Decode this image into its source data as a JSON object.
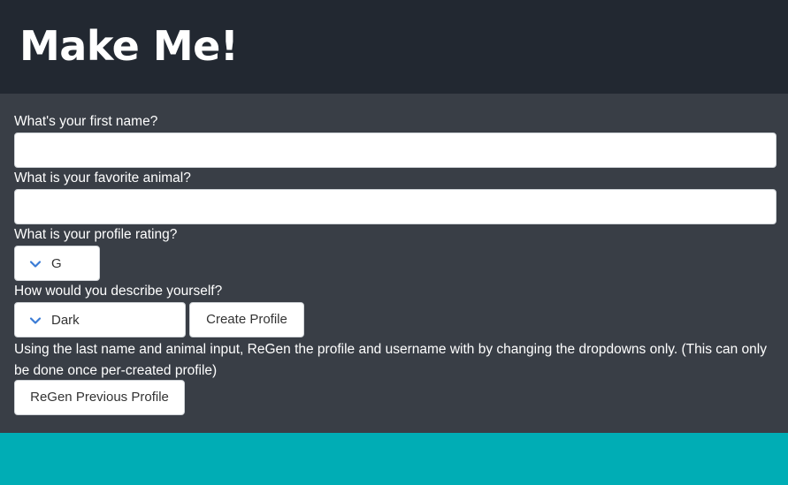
{
  "header": {
    "title": "Make Me!"
  },
  "form": {
    "first_name_label": "What's your first name?",
    "first_name_value": "",
    "animal_label": "What is your favorite animal?",
    "animal_value": "",
    "rating_label": "What is your profile rating?",
    "rating_selected": "G",
    "describe_label": "How would you describe yourself?",
    "describe_selected": "Dark",
    "create_button": "Create Profile",
    "regen_note": "Using the last name and animal input, ReGen the profile and username with by changing the dropdowns only. (This can only be done once per-created profile)",
    "regen_button": "ReGen Previous Profile"
  },
  "icons": {
    "dropdown": "chevron-down-icon"
  },
  "colors": {
    "header_bg": "#222831",
    "form_bg": "#393e46",
    "footer_bg": "#00adb5",
    "chevron": "#3a7bd5"
  }
}
